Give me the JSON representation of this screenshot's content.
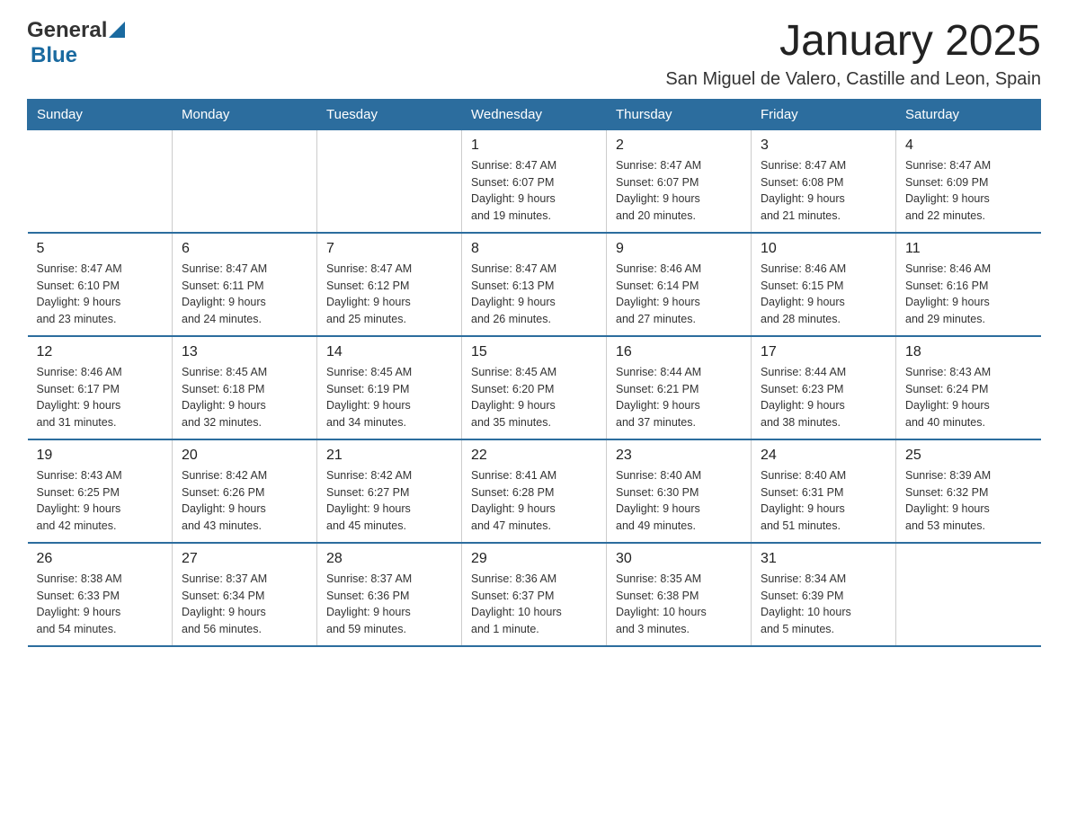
{
  "logo": {
    "general": "General",
    "blue": "Blue"
  },
  "header": {
    "month": "January 2025",
    "location": "San Miguel de Valero, Castille and Leon, Spain"
  },
  "weekdays": [
    "Sunday",
    "Monday",
    "Tuesday",
    "Wednesday",
    "Thursday",
    "Friday",
    "Saturday"
  ],
  "weeks": [
    [
      {
        "day": "",
        "info": ""
      },
      {
        "day": "",
        "info": ""
      },
      {
        "day": "",
        "info": ""
      },
      {
        "day": "1",
        "info": "Sunrise: 8:47 AM\nSunset: 6:07 PM\nDaylight: 9 hours\nand 19 minutes."
      },
      {
        "day": "2",
        "info": "Sunrise: 8:47 AM\nSunset: 6:07 PM\nDaylight: 9 hours\nand 20 minutes."
      },
      {
        "day": "3",
        "info": "Sunrise: 8:47 AM\nSunset: 6:08 PM\nDaylight: 9 hours\nand 21 minutes."
      },
      {
        "day": "4",
        "info": "Sunrise: 8:47 AM\nSunset: 6:09 PM\nDaylight: 9 hours\nand 22 minutes."
      }
    ],
    [
      {
        "day": "5",
        "info": "Sunrise: 8:47 AM\nSunset: 6:10 PM\nDaylight: 9 hours\nand 23 minutes."
      },
      {
        "day": "6",
        "info": "Sunrise: 8:47 AM\nSunset: 6:11 PM\nDaylight: 9 hours\nand 24 minutes."
      },
      {
        "day": "7",
        "info": "Sunrise: 8:47 AM\nSunset: 6:12 PM\nDaylight: 9 hours\nand 25 minutes."
      },
      {
        "day": "8",
        "info": "Sunrise: 8:47 AM\nSunset: 6:13 PM\nDaylight: 9 hours\nand 26 minutes."
      },
      {
        "day": "9",
        "info": "Sunrise: 8:46 AM\nSunset: 6:14 PM\nDaylight: 9 hours\nand 27 minutes."
      },
      {
        "day": "10",
        "info": "Sunrise: 8:46 AM\nSunset: 6:15 PM\nDaylight: 9 hours\nand 28 minutes."
      },
      {
        "day": "11",
        "info": "Sunrise: 8:46 AM\nSunset: 6:16 PM\nDaylight: 9 hours\nand 29 minutes."
      }
    ],
    [
      {
        "day": "12",
        "info": "Sunrise: 8:46 AM\nSunset: 6:17 PM\nDaylight: 9 hours\nand 31 minutes."
      },
      {
        "day": "13",
        "info": "Sunrise: 8:45 AM\nSunset: 6:18 PM\nDaylight: 9 hours\nand 32 minutes."
      },
      {
        "day": "14",
        "info": "Sunrise: 8:45 AM\nSunset: 6:19 PM\nDaylight: 9 hours\nand 34 minutes."
      },
      {
        "day": "15",
        "info": "Sunrise: 8:45 AM\nSunset: 6:20 PM\nDaylight: 9 hours\nand 35 minutes."
      },
      {
        "day": "16",
        "info": "Sunrise: 8:44 AM\nSunset: 6:21 PM\nDaylight: 9 hours\nand 37 minutes."
      },
      {
        "day": "17",
        "info": "Sunrise: 8:44 AM\nSunset: 6:23 PM\nDaylight: 9 hours\nand 38 minutes."
      },
      {
        "day": "18",
        "info": "Sunrise: 8:43 AM\nSunset: 6:24 PM\nDaylight: 9 hours\nand 40 minutes."
      }
    ],
    [
      {
        "day": "19",
        "info": "Sunrise: 8:43 AM\nSunset: 6:25 PM\nDaylight: 9 hours\nand 42 minutes."
      },
      {
        "day": "20",
        "info": "Sunrise: 8:42 AM\nSunset: 6:26 PM\nDaylight: 9 hours\nand 43 minutes."
      },
      {
        "day": "21",
        "info": "Sunrise: 8:42 AM\nSunset: 6:27 PM\nDaylight: 9 hours\nand 45 minutes."
      },
      {
        "day": "22",
        "info": "Sunrise: 8:41 AM\nSunset: 6:28 PM\nDaylight: 9 hours\nand 47 minutes."
      },
      {
        "day": "23",
        "info": "Sunrise: 8:40 AM\nSunset: 6:30 PM\nDaylight: 9 hours\nand 49 minutes."
      },
      {
        "day": "24",
        "info": "Sunrise: 8:40 AM\nSunset: 6:31 PM\nDaylight: 9 hours\nand 51 minutes."
      },
      {
        "day": "25",
        "info": "Sunrise: 8:39 AM\nSunset: 6:32 PM\nDaylight: 9 hours\nand 53 minutes."
      }
    ],
    [
      {
        "day": "26",
        "info": "Sunrise: 8:38 AM\nSunset: 6:33 PM\nDaylight: 9 hours\nand 54 minutes."
      },
      {
        "day": "27",
        "info": "Sunrise: 8:37 AM\nSunset: 6:34 PM\nDaylight: 9 hours\nand 56 minutes."
      },
      {
        "day": "28",
        "info": "Sunrise: 8:37 AM\nSunset: 6:36 PM\nDaylight: 9 hours\nand 59 minutes."
      },
      {
        "day": "29",
        "info": "Sunrise: 8:36 AM\nSunset: 6:37 PM\nDaylight: 10 hours\nand 1 minute."
      },
      {
        "day": "30",
        "info": "Sunrise: 8:35 AM\nSunset: 6:38 PM\nDaylight: 10 hours\nand 3 minutes."
      },
      {
        "day": "31",
        "info": "Sunrise: 8:34 AM\nSunset: 6:39 PM\nDaylight: 10 hours\nand 5 minutes."
      },
      {
        "day": "",
        "info": ""
      }
    ]
  ]
}
